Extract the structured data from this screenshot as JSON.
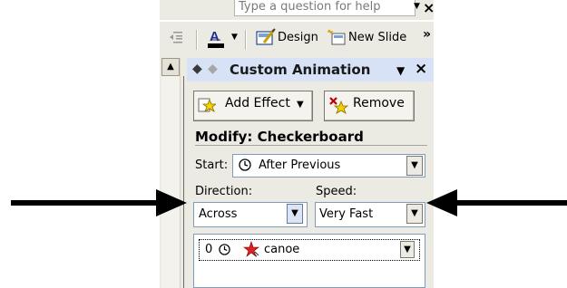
{
  "help": {
    "placeholder": "Type a question for help"
  },
  "toolbar": {
    "design_label": "Design",
    "new_slide_label": "New Slide"
  },
  "task_pane": {
    "title": "Custom Animation",
    "add_effect_label": "Add Effect",
    "remove_label": "Remove",
    "modify_title": "Modify: Checkerboard",
    "start_label": "Start:",
    "start_value": "After Previous",
    "direction_label": "Direction:",
    "direction_value": "Across",
    "speed_label": "Speed:",
    "speed_value": "Very Fast",
    "list_items": [
      {
        "order": "0",
        "name": "canoe"
      }
    ]
  },
  "colors": {
    "arrow": "#000000",
    "pane_header": "#d7e2f6",
    "panel_bg": "#ecebe3"
  }
}
